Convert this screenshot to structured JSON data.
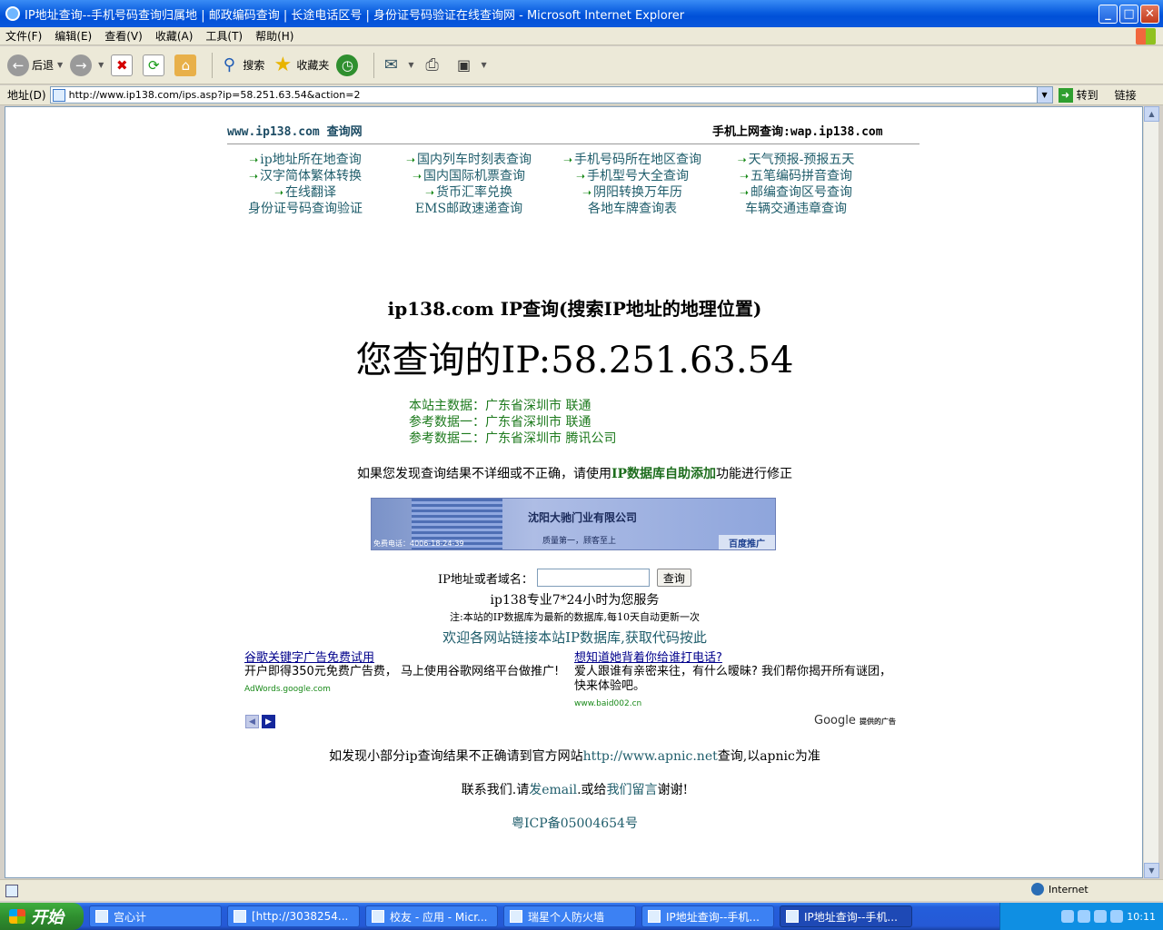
{
  "window": {
    "title": "IP地址查询--手机号码查询归属地 | 邮政编码查询 | 长途电话区号 | 身份证号码验证在线查询网 - Microsoft Internet Explorer",
    "min": "_",
    "max": "□",
    "close": "✕"
  },
  "menu": [
    "文件(F)",
    "编辑(E)",
    "查看(V)",
    "收藏(A)",
    "工具(T)",
    "帮助(H)"
  ],
  "toolbar": {
    "back": "后退",
    "search": "搜索",
    "favorites": "收藏夹"
  },
  "address": {
    "label": "地址(D)",
    "url": "http://www.ip138.com/ips.asp?ip=58.251.63.54&action=2",
    "go": "转到",
    "links": "链接"
  },
  "page": {
    "site": "www.ip138.com 查询网",
    "mobile": "手机上网查询:wap.ip138.com",
    "nav": [
      [
        "ip地址所在地查询",
        "国内列车时刻表查询",
        "手机号码所在地区查询",
        "天气预报-预报五天"
      ],
      [
        "汉字简体繁体转换",
        "国内国际机票查询",
        "手机型号大全查询",
        "五笔编码拼音查询"
      ],
      [
        "在线翻译",
        "货币汇率兑换",
        "阴阳转换万年历",
        "邮编查询区号查询"
      ],
      [
        "身份证号码查询验证",
        "EMS邮政速递查询",
        "各地车牌查询表",
        "车辆交通违章查询"
      ]
    ],
    "headline": "ip138.com IP查询(搜索IP地址的地理位置)",
    "ip_line": "您查询的IP:58.251.63.54",
    "results": [
      "本站主数据：广东省深圳市 联通",
      "参考数据一：广东省深圳市 联通",
      "参考数据二：广东省深圳市 腾讯公司"
    ],
    "fix_prefix": "如果您发现查询结果不详细或不正确，请使用",
    "fix_link": "IP数据库自助添加",
    "fix_suffix": "功能进行修正",
    "banner": {
      "title": "沈阳大驰门业有限公司",
      "sub": "质量第一，顾客至上",
      "phone": "免费电话：4006-18-24-39",
      "brand": "百度推广"
    },
    "query_label": "IP地址或者域名：",
    "query_button": "查询",
    "service": "ip138专业7*24小时为您服务",
    "note": "注:本站的IP数据库为最新的数据库,每10天自动更新一次",
    "welcome": "欢迎各网站链接本站IP数据库,获取代码按此",
    "ads": [
      {
        "title": "谷歌关键字广告免费试用",
        "body": "开户即得350元免费广告费， 马上使用谷歌网络平台做推广!",
        "url": "AdWords.google.com"
      },
      {
        "title": "想知道她背着你给谁打电话?",
        "body": "爱人跟谁有亲密来往，有什么暧昧? 我们帮你揭开所有谜团，快来体验吧。",
        "url": "www.baid002.cn"
      }
    ],
    "google_brand": "Google",
    "google_suffix": "提供的广告",
    "apnic_prefix": "如发现小部分ip查询结果不正确请到官方网站",
    "apnic_link": "http://www.apnic.net",
    "apnic_suffix": "查询,以apnic为准",
    "contact_a": "联系我们.请",
    "contact_link1": "发email",
    "contact_b": ".或给",
    "contact_link2": "我们留言",
    "contact_c": "谢谢!",
    "icp": "粤ICP备05004654号"
  },
  "status": {
    "zone": "Internet"
  },
  "taskbar": {
    "start": "开始",
    "tasks": [
      "宫心计",
      "[http://3038254...",
      "校友 - 应用 - Micr...",
      "瑞星个人防火墙",
      "IP地址查询--手机...",
      "IP地址查询--手机..."
    ],
    "clock": "10:11"
  }
}
